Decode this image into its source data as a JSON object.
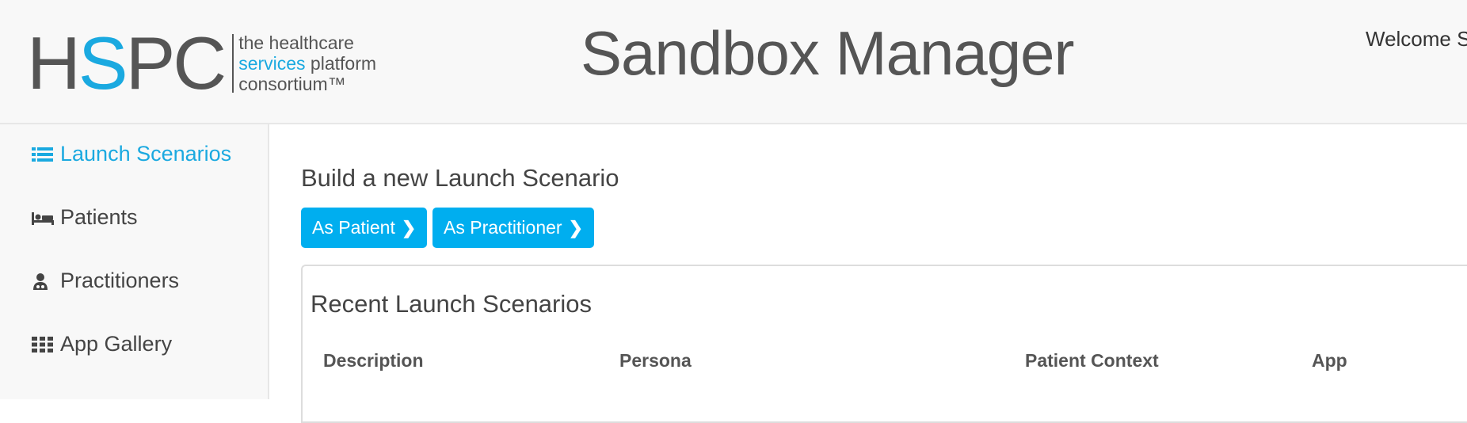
{
  "header": {
    "logo_prefix": "H",
    "logo_s": "S",
    "logo_suffix": "PC",
    "tagline_1": "the healthcare",
    "tagline_2_highlight": "services",
    "tagline_2_rest": " platform",
    "tagline_3": "consortium™",
    "app_title": "Sandbox Manager",
    "welcome": "Welcome S"
  },
  "sidebar": {
    "items": [
      {
        "label": "Launch Scenarios",
        "icon": "list-icon",
        "active": true
      },
      {
        "label": "Patients",
        "icon": "bed-icon",
        "active": false
      },
      {
        "label": "Practitioners",
        "icon": "doctor-icon",
        "active": false
      },
      {
        "label": "App Gallery",
        "icon": "grid-icon",
        "active": false
      }
    ]
  },
  "main": {
    "build_heading": "Build a new Launch Scenario",
    "buttons": [
      {
        "label": "As Patient",
        "icon": "chevron-right-icon"
      },
      {
        "label": "As Practitioner",
        "icon": "chevron-right-icon"
      }
    ],
    "recent_heading": "Recent Launch Scenarios",
    "table": {
      "columns": [
        "Description",
        "Persona",
        "Patient Context",
        "App"
      ]
    }
  },
  "colors": {
    "accent": "#1aa9e0",
    "button": "#00aeef",
    "header_bg": "#f8f8f8",
    "text": "#444444"
  }
}
